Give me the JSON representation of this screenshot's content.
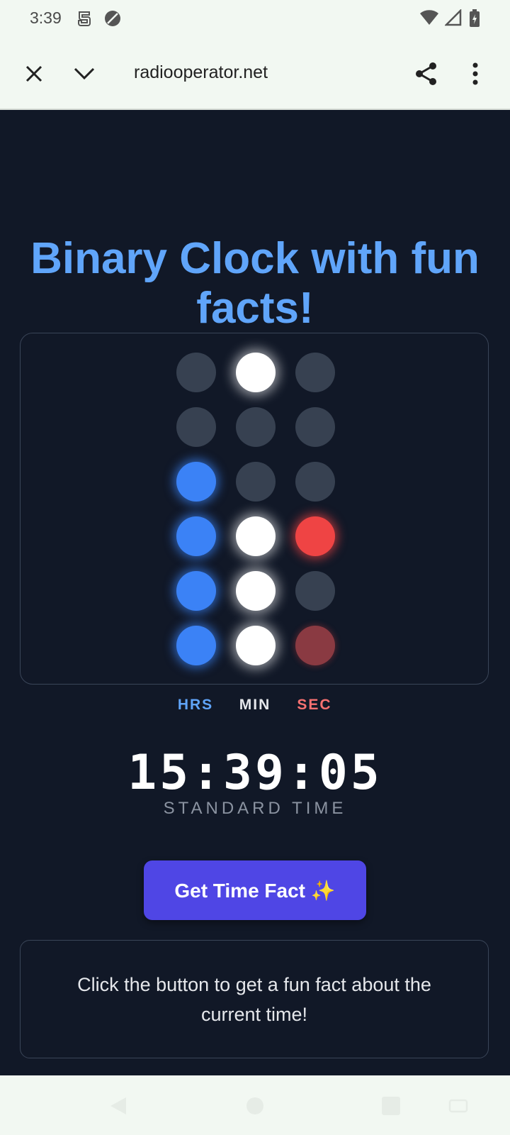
{
  "status_bar": {
    "time": "3:39"
  },
  "browser": {
    "url": "radiooperator.net"
  },
  "page": {
    "title": "Binary Clock with fun facts!",
    "labels": {
      "hours": "HRS",
      "minutes": "MIN",
      "seconds": "SEC"
    },
    "digital_time": "15:39:05",
    "mode_label": "STANDARD TIME",
    "button_label": "Get Time Fact ✨",
    "fact_text": "Click the button to get a fun fact about the current time!"
  },
  "binary_clock": {
    "rows": 6,
    "columns": [
      {
        "name": "hours",
        "bits": [
          0,
          0,
          1,
          1,
          1,
          1
        ],
        "on_color": "#3b82f6"
      },
      {
        "name": "minutes",
        "bits": [
          1,
          0,
          0,
          1,
          1,
          1
        ],
        "on_color": "#ffffff"
      },
      {
        "name": "seconds",
        "bits": [
          0,
          0,
          0,
          1,
          0,
          1
        ],
        "on_color": "#ef4444"
      }
    ]
  },
  "colors": {
    "background": "#111827",
    "title": "#60a5fa",
    "hours": "#60a5fa",
    "minutes": "#e5e7eb",
    "seconds": "#f87171",
    "button": "#4f46e5"
  }
}
